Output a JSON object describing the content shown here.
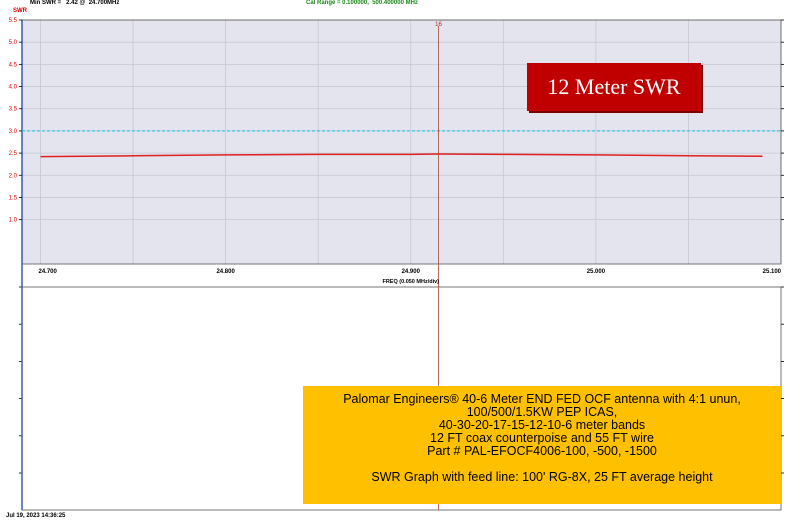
{
  "header": {
    "min_swr": "Min SWR =   2.42 @  24.700MHz",
    "cal_range": "Cal Range = 0.100000,  500.400000 MHz"
  },
  "chart_data": {
    "type": "line",
    "title": "12 Meter SWR",
    "ylabel": "SWR",
    "xlabel": "FREQ (0.050 MHz/div)",
    "xlim": [
      24.69,
      25.1
    ],
    "ylim": [
      0,
      5.5
    ],
    "x_ticks": [
      24.7,
      24.8,
      24.9,
      25.0,
      25.1
    ],
    "x_tick_labels": [
      "24.700",
      "24.800",
      "24.900",
      "25.000",
      "25.100"
    ],
    "y_ticks": [
      1.0,
      1.5,
      2.0,
      2.5,
      3.0,
      3.5,
      4.0,
      4.5,
      5.0,
      5.5
    ],
    "y_tick_labels": [
      "1.0",
      "1.5",
      "2.0",
      "2.5",
      "3.0",
      "3.5",
      "4.0",
      "4.5",
      "5.0",
      "5.5"
    ],
    "reference_line": {
      "value": 3.0,
      "label": "3.0",
      "color": "#33c6e6"
    },
    "marker": {
      "x": 24.915,
      "label": "16",
      "color": "#b05a4a"
    },
    "series": [
      {
        "color": "#e02020",
        "x": [
          24.7,
          24.75,
          24.8,
          24.85,
          24.9,
          24.915,
          24.95,
          25.0,
          25.05,
          25.09
        ],
        "y": [
          2.42,
          2.44,
          2.46,
          2.47,
          2.47,
          2.48,
          2.47,
          2.46,
          2.44,
          2.43
        ]
      }
    ],
    "grid": true,
    "colors": {
      "plot_bg": "#e4e4ee",
      "grid": "#c7c7d4",
      "tick_text": "#e00000",
      "axis_left": "#2b4fbf"
    }
  },
  "annotation_box": {
    "lines": [
      "Palomar Engineers® 40-6 Meter END FED OCF antenna with 4:1 unun,",
      "100/500/1.5KW PEP ICAS,",
      "40-30-20-17-15-12-10-6 meter bands",
      "12 FT coax counterpoise and 55 FT wire",
      "Part # PAL-EFOCF4006-100, -500, -1500"
    ],
    "footer": "SWR Graph with feed line: 100' RG-8X, 25 FT average height"
  },
  "footer": {
    "timestamp": "Jul 19, 2023  14:36:25"
  }
}
